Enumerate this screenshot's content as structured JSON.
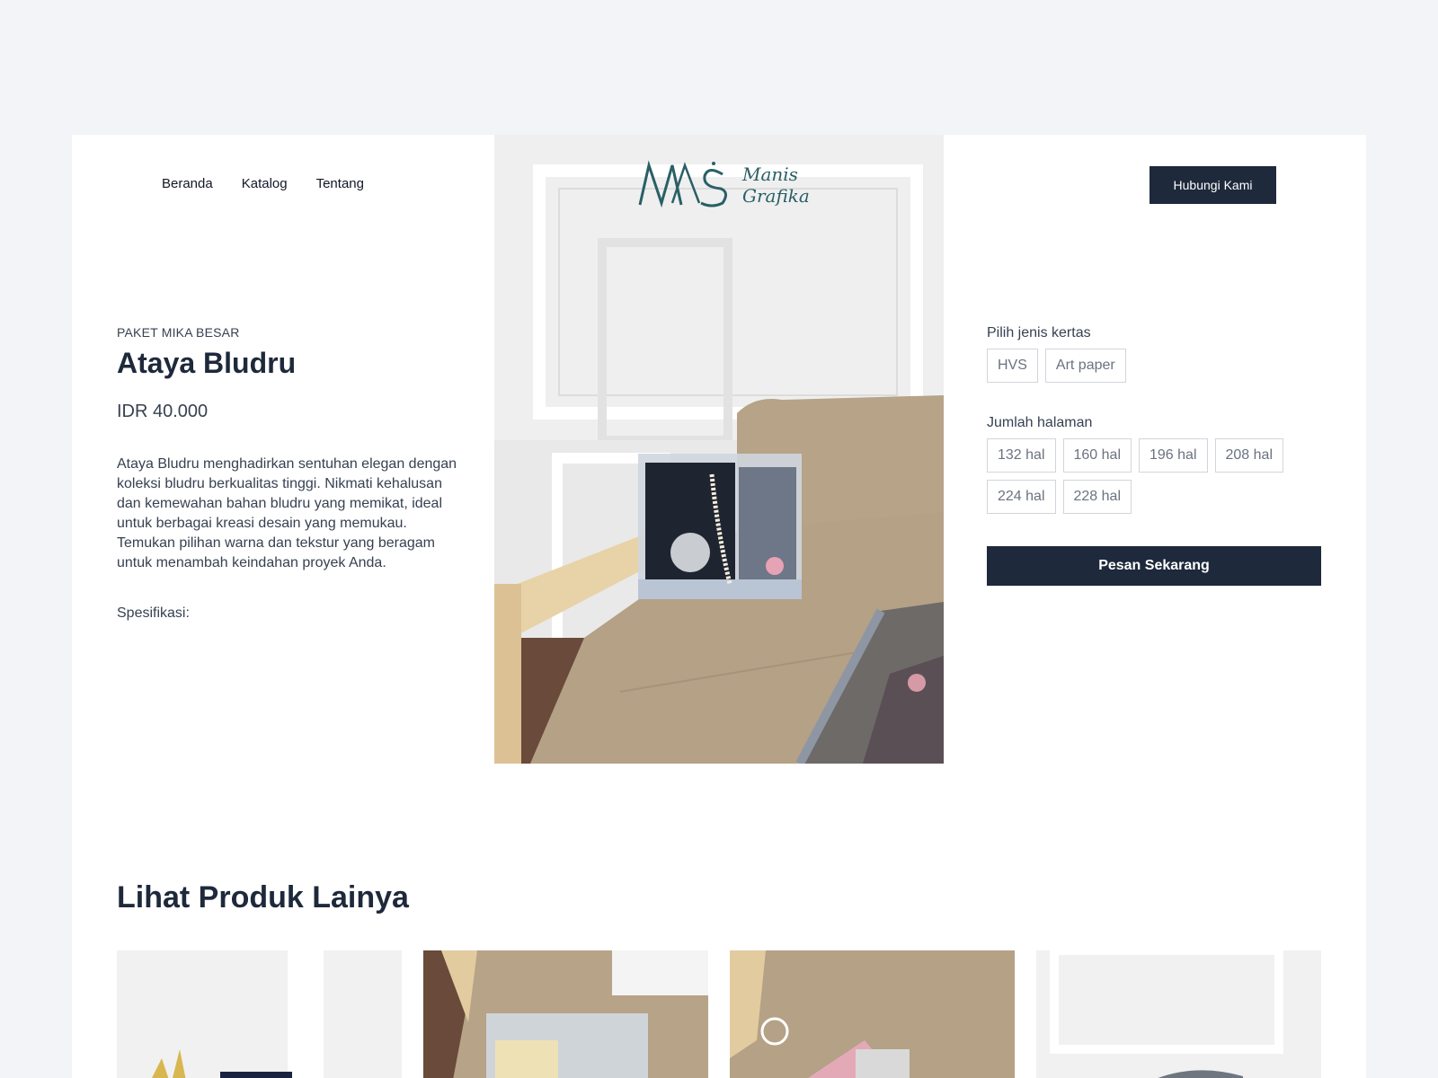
{
  "nav": {
    "items": [
      "Beranda",
      "Katalog",
      "Tentang"
    ],
    "contact_label": "Hubungi Kami"
  },
  "logo": {
    "line1": "Manis",
    "line2": "Grafika",
    "mark": "MNS",
    "color": "#2a5f66"
  },
  "product": {
    "eyebrow": "PAKET MIKA BESAR",
    "title": "Ataya Bludru",
    "price": "IDR 40.000",
    "description": "Ataya Bludru menghadirkan sentuhan elegan dengan koleksi bludru berkualitas tinggi. Nikmati kehalusan dan kemewahan bahan bludru yang memikat, ideal untuk berbagai kreasi desain yang memukau. Temukan pilihan warna dan tekstur yang beragam untuk menambah keindahan proyek Anda.",
    "spec_label": "Spesifikasi:"
  },
  "options": {
    "paper_label": "Pilih jenis kertas",
    "paper_types": [
      "HVS",
      "Art paper"
    ],
    "pages_label": "Jumlah halaman",
    "pages": [
      "132 hal",
      "160 hal",
      "196 hal",
      "208 hal",
      "224 hal",
      "228 hal"
    ],
    "order_label": "Pesan Sekarang"
  },
  "related": {
    "title": "Lihat Produk Lainya",
    "items": [
      "product-thumb-1",
      "product-thumb-2",
      "product-thumb-3",
      "product-thumb-4"
    ]
  },
  "colors": {
    "primary": "#1e293b",
    "background": "#f3f4f8",
    "chair": "#b8a58a",
    "wall": "#f2f2f2"
  }
}
